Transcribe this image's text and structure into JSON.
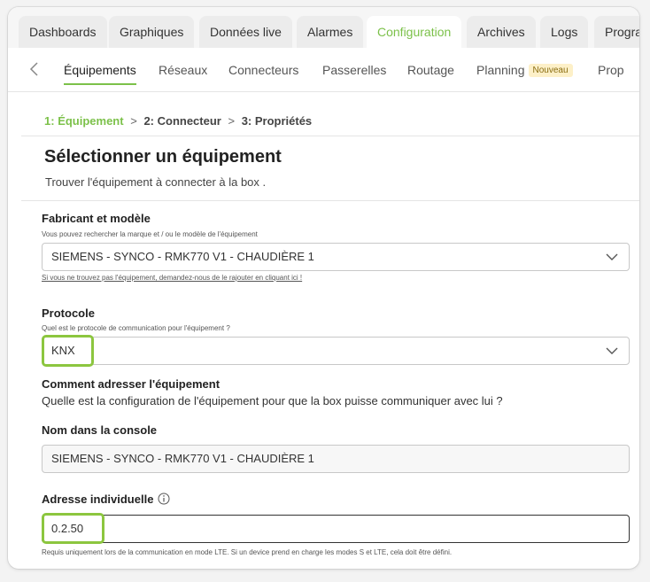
{
  "tabs": [
    "Dashboards",
    "Graphiques",
    "Données live",
    "Alarmes",
    "Configuration",
    "Archives",
    "Logs",
    "Progra"
  ],
  "active_tab": "Configuration",
  "subnav": {
    "items": [
      "Équipements",
      "Réseaux",
      "Connecteurs",
      "Passerelles",
      "Routage",
      "Planning",
      "Prop"
    ],
    "badge": "Nouveau"
  },
  "stepper": {
    "step1_num": "1:",
    "step1_label": "Équipement",
    "sep1": ">",
    "step2": "2:  Connecteur",
    "sep2": ">",
    "step3": "3:  Propriétés"
  },
  "header": {
    "title": "Sélectionner un équipement",
    "subtitle": "Trouver l'équipement à connecter à la box ."
  },
  "manufacturer": {
    "label": "Fabricant et modèle",
    "hint": "Vous pouvez rechercher la marque et / ou le modèle de l'équipement",
    "value": "SIEMENS - SYNCO - RMK770 V1 - CHAUDIÈRE 1",
    "link": "Si vous ne trouvez pas l'équipement, demandez-nous de le rajouter en cliquant ici !"
  },
  "protocol": {
    "label": "Protocole",
    "hint": "Quel est le protocole de communication pour l'équipement ?",
    "value": "KNX"
  },
  "addressing": {
    "label": "Comment adresser l'équipement",
    "description": "Quelle est la configuration de l'équipement pour que la box puisse communiquer avec lui ?"
  },
  "console_name": {
    "label": "Nom dans la console",
    "value": "SIEMENS - SYNCO - RMK770 V1 - CHAUDIÈRE 1"
  },
  "individual_address": {
    "label": "Adresse individuelle",
    "value": "0.2.50",
    "hint": "Requis uniquement lors de la communication en mode LTE. Si un device prend en charge les modes S et LTE, cela doit être défini."
  },
  "colors": {
    "accent": "#7cc14a",
    "highlight": "#8cc63f"
  },
  "icons": [
    "chevron-left-icon",
    "chevron-down-icon",
    "info-icon"
  ]
}
